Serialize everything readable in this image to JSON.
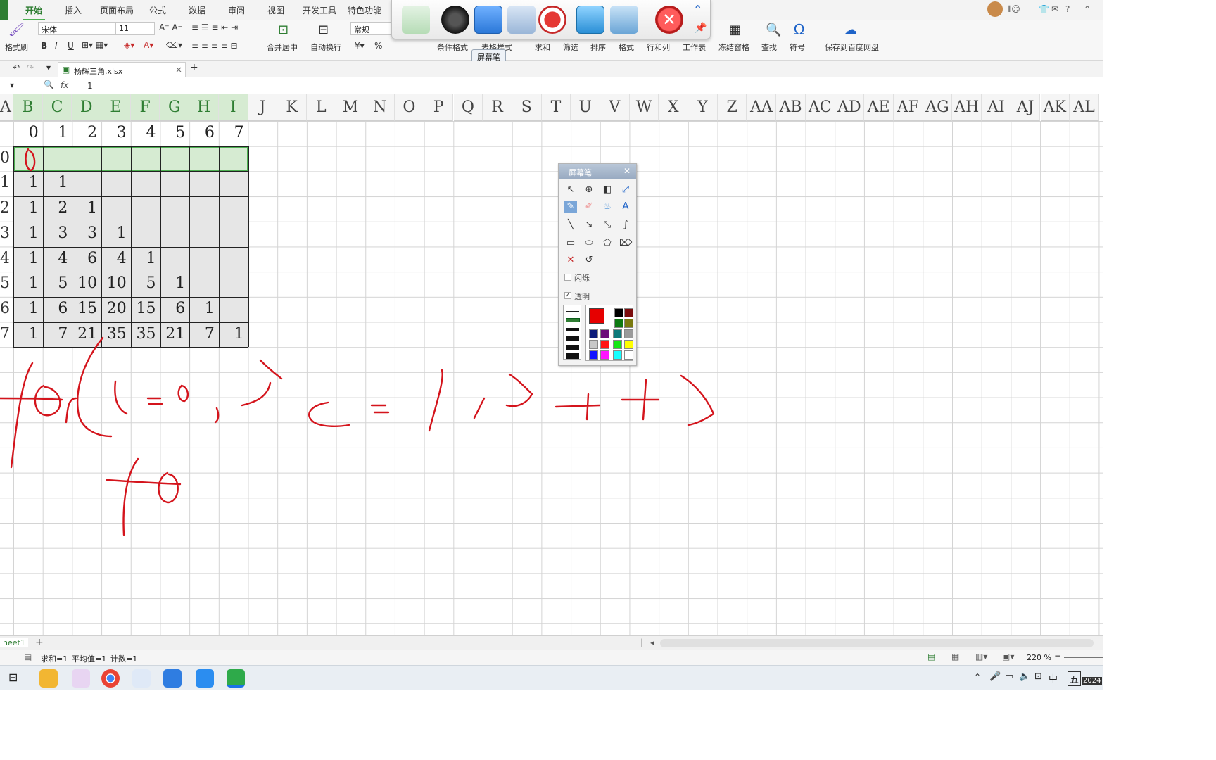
{
  "ribbon": {
    "tabs": [
      "开始",
      "插入",
      "页面布局",
      "公式",
      "数据",
      "审阅",
      "视图",
      "开发工具",
      "特色功能"
    ],
    "font_name": "宋体",
    "font_size": "11",
    "number_format": "常规",
    "labels": {
      "format_painter": "格式刷",
      "merge_center": "合并居中",
      "wrap_text": "自动换行",
      "conditional_format": "条件格式",
      "table_style": "表格样式",
      "sum": "求和",
      "filter": "筛选",
      "sort": "排序",
      "format": "格式",
      "rows_cols": "行和列",
      "worksheet": "工作表",
      "freeze": "冻结窗格",
      "find": "查找",
      "symbol": "符号",
      "save_cloud": "保存到百度网盘"
    },
    "bold": "B",
    "italic": "I",
    "underline": "U",
    "percent": "%",
    "help": "?"
  },
  "pen_tooltip": "屏幕笔",
  "document": {
    "tab_name": "杨辉三角.xlsx",
    "close": "×",
    "add": "+"
  },
  "formula_bar": {
    "fx": "fx",
    "value": "1"
  },
  "columns": [
    "A",
    "B",
    "C",
    "D",
    "E",
    "F",
    "G",
    "H",
    "I",
    "J",
    "K",
    "L",
    "M",
    "N",
    "O",
    "P",
    "Q",
    "R",
    "S",
    "T",
    "U",
    "V",
    "W",
    "X",
    "Y",
    "Z",
    "AA",
    "AB",
    "AC",
    "AD",
    "AE",
    "AF",
    "AG",
    "AH",
    "AI",
    "AJ",
    "AK",
    "AL"
  ],
  "triangle": {
    "header": [
      "0",
      "1",
      "2",
      "3",
      "4",
      "5",
      "6",
      "7"
    ],
    "row_labels": [
      "0",
      "1",
      "2",
      "3",
      "4",
      "5",
      "6",
      "7"
    ],
    "rows": [
      [
        "",
        "",
        "",
        "",
        "",
        "",
        "",
        ""
      ],
      [
        "1",
        "1",
        "",
        "",
        "",
        "",
        "",
        ""
      ],
      [
        "1",
        "2",
        "1",
        "",
        "",
        "",
        "",
        ""
      ],
      [
        "1",
        "3",
        "3",
        "1",
        "",
        "",
        "",
        ""
      ],
      [
        "1",
        "4",
        "6",
        "4",
        "1",
        "",
        "",
        ""
      ],
      [
        "1",
        "5",
        "10",
        "10",
        "5",
        "1",
        "",
        ""
      ],
      [
        "1",
        "6",
        "15",
        "20",
        "15",
        "6",
        "1",
        ""
      ],
      [
        "1",
        "7",
        "21",
        "35",
        "35",
        "21",
        "7",
        "1"
      ]
    ]
  },
  "pen_panel": {
    "title": "屏幕笔",
    "flash": "闪烁",
    "transparent": "透明"
  },
  "sheet": {
    "name": "heet1",
    "add": "+"
  },
  "status": {
    "sum": "求和=1",
    "avg": "平均值=1",
    "count": "计数=1",
    "zoom": "220 %"
  },
  "taskbar": {
    "ime": "中",
    "ime2": "五",
    "year": "2024"
  },
  "colors": {
    "ink": "#d4141c",
    "accent": "#2e7d32",
    "selection": "#d6ebd2"
  }
}
